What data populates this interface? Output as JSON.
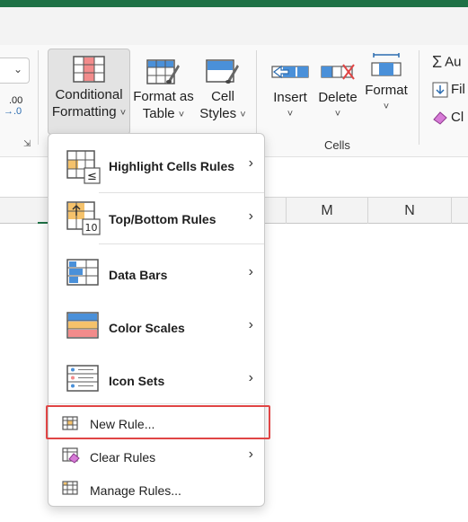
{
  "ribbon": {
    "conditional_formatting": {
      "line1": "Conditional",
      "line2": "Formatting"
    },
    "format_as_table": {
      "line1": "Format as",
      "line2": "Table"
    },
    "cell_styles": {
      "line1": "Cell",
      "line2": "Styles"
    },
    "insert": {
      "label": "Insert"
    },
    "delete": {
      "label": "Delete"
    },
    "format": {
      "label": "Format"
    },
    "cells_group_label": "Cells",
    "autosum_label": "Au",
    "fill_label": "Fil",
    "clear_label": "Cl",
    "decimal_text": ".00",
    "decimal_arrow": "→.0",
    "dropdown_glyph": "⌄",
    "chevron_glyph": "˅"
  },
  "column_headers": [
    "M",
    "N"
  ],
  "menu": {
    "items": [
      {
        "label": "Highlight Cells Rules",
        "icon": "highlight-cells-rules-icon",
        "has_submenu": true
      },
      {
        "label": "Top/Bottom Rules",
        "icon": "top-bottom-rules-icon",
        "has_submenu": true
      },
      {
        "label": "Data Bars",
        "icon": "data-bars-icon",
        "has_submenu": true
      },
      {
        "label": "Color Scales",
        "icon": "color-scales-icon",
        "has_submenu": true
      },
      {
        "label": "Icon Sets",
        "icon": "icon-sets-icon",
        "has_submenu": true
      },
      {
        "label": "New Rule...",
        "icon": "new-rule-icon",
        "has_submenu": false
      },
      {
        "label": "Clear Rules",
        "icon": "clear-rules-icon",
        "has_submenu": true
      },
      {
        "label": "Manage Rules...",
        "icon": "manage-rules-icon",
        "has_submenu": false
      }
    ],
    "submenu_arrow": "›",
    "top_bottom_icon_number": "10",
    "highlight_icon_symbol": "≤"
  },
  "colors": {
    "accent": "#1e7145",
    "highlight_border": "#e04545",
    "table_blue": "#4a90d9",
    "rule_orange": "#f5c26b",
    "rule_red": "#f28b8b"
  }
}
